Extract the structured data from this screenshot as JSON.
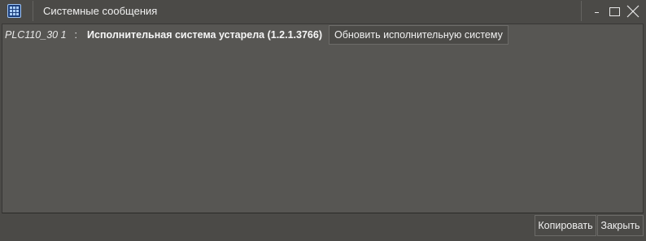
{
  "window": {
    "title": "Системные сообщения",
    "icon": "grid-app-icon",
    "controls": {
      "minimize": "minimize-icon",
      "maximize": "maximize-icon",
      "close": "close-icon"
    }
  },
  "messages": [
    {
      "device": "PLC110_30 1",
      "separator": ":",
      "text": "Исполнительная система устарела (1.2.1.3766)",
      "action_label": "Обновить исполнительную систему"
    }
  ],
  "footer": {
    "copy_label": "Копировать",
    "close_label": "Закрыть"
  },
  "colors": {
    "background": "#4b4a47",
    "panel": "#575653",
    "text": "#f0f0f0",
    "icon_accent": "#1c3f7c"
  }
}
